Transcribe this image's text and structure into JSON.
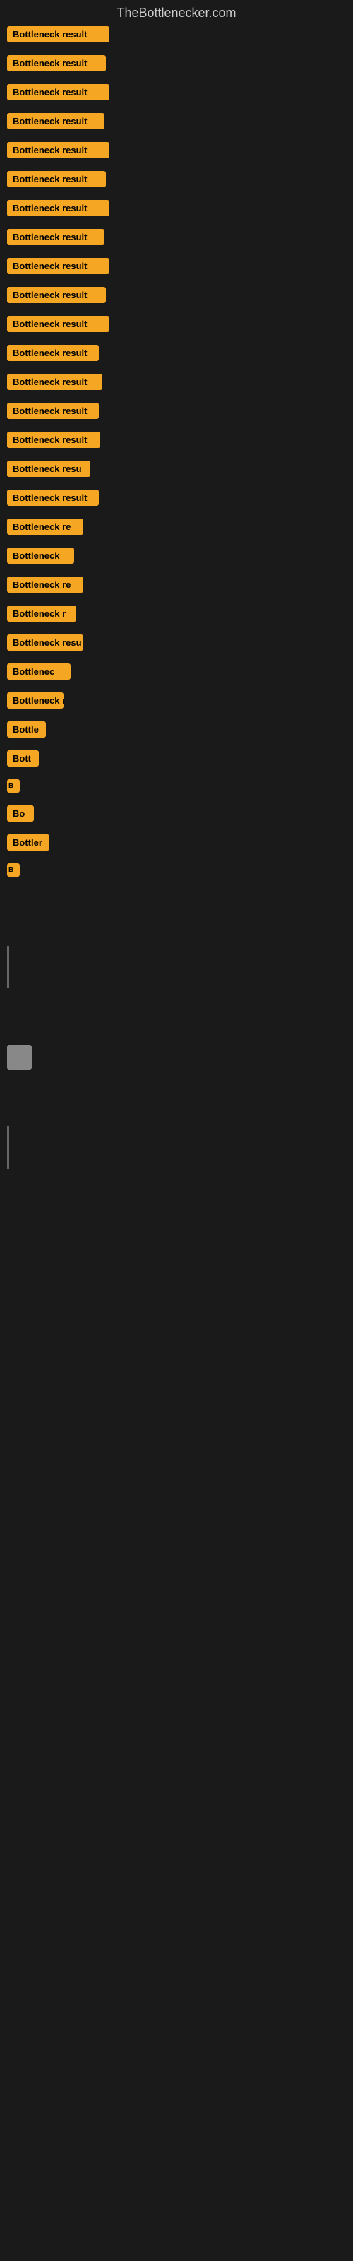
{
  "site": {
    "title": "TheBottlenecker.com"
  },
  "items": [
    {
      "id": 1,
      "label": "Bottleneck result",
      "badge_class": "badge-w1"
    },
    {
      "id": 2,
      "label": "Bottleneck result",
      "badge_class": "badge-w2"
    },
    {
      "id": 3,
      "label": "Bottleneck result",
      "badge_class": "badge-w3"
    },
    {
      "id": 4,
      "label": "Bottleneck result",
      "badge_class": "badge-w4"
    },
    {
      "id": 5,
      "label": "Bottleneck result",
      "badge_class": "badge-w5"
    },
    {
      "id": 6,
      "label": "Bottleneck result",
      "badge_class": "badge-w6"
    },
    {
      "id": 7,
      "label": "Bottleneck result",
      "badge_class": "badge-w7"
    },
    {
      "id": 8,
      "label": "Bottleneck result",
      "badge_class": "badge-w8"
    },
    {
      "id": 9,
      "label": "Bottleneck result",
      "badge_class": "badge-w9"
    },
    {
      "id": 10,
      "label": "Bottleneck result",
      "badge_class": "badge-w10"
    },
    {
      "id": 11,
      "label": "Bottleneck result",
      "badge_class": "badge-w11"
    },
    {
      "id": 12,
      "label": "Bottleneck result",
      "badge_class": "badge-w12"
    },
    {
      "id": 13,
      "label": "Bottleneck result",
      "badge_class": "badge-w13"
    },
    {
      "id": 14,
      "label": "Bottleneck result",
      "badge_class": "badge-w14"
    },
    {
      "id": 15,
      "label": "Bottleneck result",
      "badge_class": "badge-w15"
    },
    {
      "id": 16,
      "label": "Bottleneck resu",
      "badge_class": "badge-w16"
    },
    {
      "id": 17,
      "label": "Bottleneck result",
      "badge_class": "badge-w17"
    },
    {
      "id": 18,
      "label": "Bottleneck re",
      "badge_class": "badge-w18"
    },
    {
      "id": 19,
      "label": "Bottleneck",
      "badge_class": "badge-w19"
    },
    {
      "id": 20,
      "label": "Bottleneck re",
      "badge_class": "badge-w20"
    },
    {
      "id": 21,
      "label": "Bottleneck r",
      "badge_class": "badge-w21"
    },
    {
      "id": 22,
      "label": "Bottleneck resu",
      "badge_class": "badge-w22"
    },
    {
      "id": 23,
      "label": "Bottlenec",
      "badge_class": "badge-w23"
    },
    {
      "id": 24,
      "label": "Bottleneck r",
      "badge_class": "badge-w24"
    },
    {
      "id": 25,
      "label": "Bottle",
      "badge_class": "badge-w25"
    },
    {
      "id": 26,
      "label": "Bott",
      "badge_class": "badge-w26"
    },
    {
      "id": 27,
      "label": "B",
      "badge_class": "badge-w27"
    },
    {
      "id": 28,
      "label": "Bo",
      "badge_class": "badge-w28"
    },
    {
      "id": 29,
      "label": "Bottler",
      "badge_class": "badge-w29"
    },
    {
      "id": 30,
      "label": "B",
      "badge_class": "badge-w30"
    }
  ]
}
